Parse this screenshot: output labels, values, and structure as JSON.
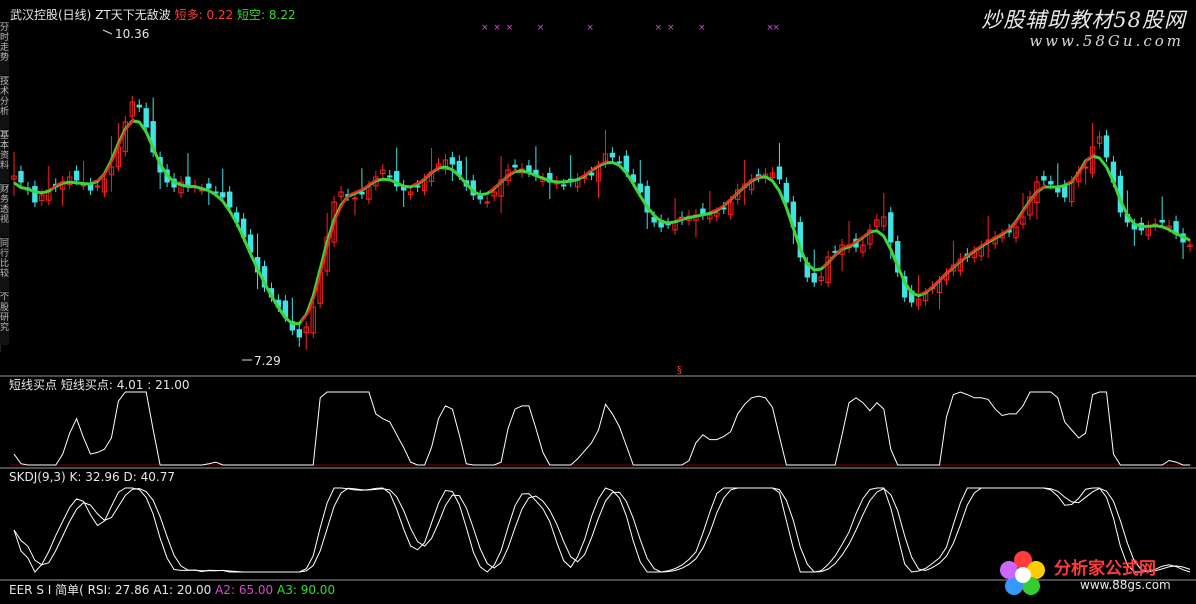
{
  "header": {
    "name": "武汉控股(日线)",
    "indicator": "ZT天下无敌波",
    "bull_label": "短多:",
    "bull_value": "0.22",
    "bear_label": "短空:",
    "bear_value": "8.22"
  },
  "price_high_label": "10.36",
  "price_low_label": "7.29",
  "side_tabs": [
    "分时走势",
    "技术分析",
    "基本资料",
    "财务透视",
    "同行比较",
    "个股研究"
  ],
  "watermark": {
    "line1": "炒股辅助教材58股网",
    "line2": "www.58Gu.com",
    "logo": "分析家公式网",
    "logo_url": "www.88gs.com"
  },
  "panels": {
    "p2": {
      "title": "短线买点",
      "value_label": "短线买点:",
      "value": "4.01 : 21.00"
    },
    "p3": {
      "title": "SKDJ(9,3)",
      "k_label": "K:",
      "k": "32.96",
      "d_label": "D:",
      "d": "40.77"
    },
    "p4": {
      "title": "EER S I 简单(",
      "rsi_label": "RSI:",
      "rsi": "27.86",
      "a1_label": "A1:",
      "a1": "20.00",
      "a2_label": "A2:",
      "a2": "65.00",
      "a3_label": "A3:",
      "a3": "90.00"
    }
  },
  "colors": {
    "up": "#ff2020",
    "down": "#3fe3e3",
    "wave": "#3ad63a",
    "line": "#ffffff",
    "marker": "#d050d0",
    "grid": "#7a0000"
  },
  "chart_data": [
    {
      "type": "candlestick",
      "title": "武汉控股(日线)",
      "ylim": [
        7.0,
        10.5
      ],
      "annotations": [
        "10.36",
        "7.29"
      ],
      "close": [
        8.96,
        8.9,
        8.82,
        8.7,
        8.77,
        8.82,
        8.85,
        8.9,
        8.95,
        8.92,
        8.87,
        8.82,
        8.86,
        8.93,
        9.05,
        9.25,
        9.5,
        9.7,
        9.65,
        9.45,
        9.2,
        9.0,
        8.9,
        8.85,
        8.9,
        8.85,
        8.86,
        8.82,
        8.84,
        8.8,
        8.75,
        8.65,
        8.5,
        8.35,
        8.2,
        8.0,
        7.85,
        7.75,
        7.65,
        7.55,
        7.42,
        7.35,
        7.45,
        7.65,
        8.0,
        8.35,
        8.7,
        8.8,
        8.76,
        8.74,
        8.78,
        8.85,
        8.95,
        9.02,
        8.96,
        8.86,
        8.82,
        8.8,
        8.85,
        8.92,
        9.0,
        9.08,
        9.12,
        9.08,
        8.97,
        8.86,
        8.77,
        8.73,
        8.7,
        8.8,
        8.92,
        9.02,
        9.05,
        9.03,
        9.0,
        8.96,
        8.93,
        8.9,
        8.9,
        8.87,
        8.9,
        8.93,
        8.95,
        8.97,
        9.05,
        9.18,
        9.15,
        9.1,
        9.0,
        8.9,
        8.8,
        8.6,
        8.5,
        8.45,
        8.48,
        8.5,
        8.52,
        8.56,
        8.57,
        8.57,
        8.57,
        8.59,
        8.63,
        8.7,
        8.82,
        8.88,
        8.92,
        8.95,
        8.98,
        8.99,
        8.93,
        8.7,
        8.45,
        8.15,
        7.95,
        7.9,
        7.95,
        8.15,
        8.2,
        8.27,
        8.27,
        8.25,
        8.27,
        8.42,
        8.52,
        8.55,
        8.3,
        8.0,
        7.75,
        7.7,
        7.73,
        7.78,
        7.85,
        7.9,
        7.98,
        8.07,
        8.13,
        8.15,
        8.2,
        8.25,
        8.32,
        8.35,
        8.37,
        8.4,
        8.45,
        8.55,
        8.75,
        8.9,
        8.92,
        8.88,
        8.8,
        8.75,
        8.9,
        9.0,
        9.05,
        9.25,
        9.35,
        9.15,
        8.9,
        8.6,
        8.5,
        8.43,
        8.42,
        8.45,
        8.48,
        8.5,
        8.46,
        8.38,
        8.3,
        8.27
      ],
      "markers": [
        5,
        7,
        9,
        14,
        22,
        33,
        35,
        40,
        51,
        52
      ]
    },
    {
      "type": "line",
      "title": "短线买点",
      "series": [
        {
          "name": "短线买点"
        }
      ]
    },
    {
      "type": "line",
      "title": "SKDJ(9,3)",
      "series": [
        {
          "name": "K"
        },
        {
          "name": "D"
        }
      ]
    },
    {
      "type": "line",
      "title": "EER S I 简单(",
      "series": [
        {
          "name": "RSI"
        },
        {
          "name": "A1"
        },
        {
          "name": "A2"
        },
        {
          "name": "A3"
        }
      ]
    }
  ]
}
